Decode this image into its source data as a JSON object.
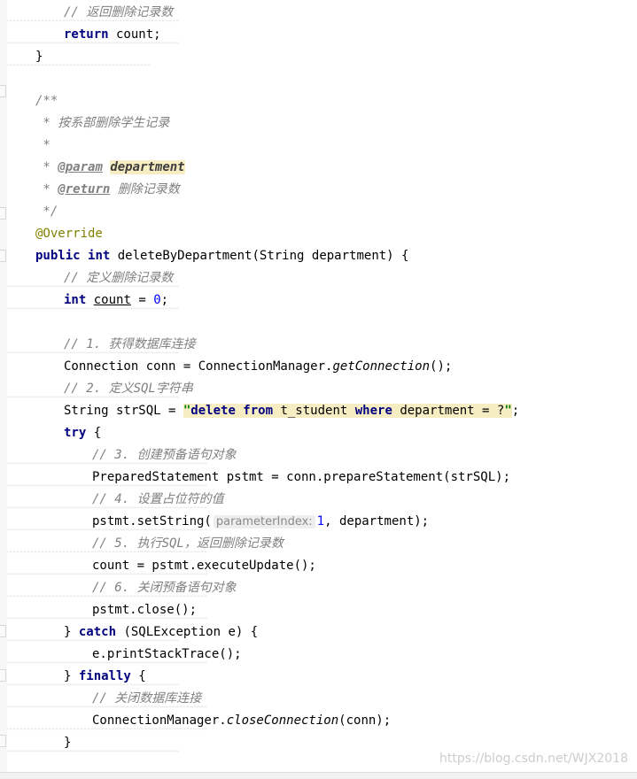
{
  "editor": {
    "code_lines": [
      {
        "tokens": [
          {
            "c": "cm",
            "t": "// 返回删除记录数"
          }
        ]
      },
      {
        "tokens": [
          {
            "c": "kw",
            "t": "return"
          },
          {
            "c": "",
            "t": " count;"
          }
        ]
      },
      {
        "tokens": [
          {
            "c": "",
            "t": "}"
          }
        ]
      },
      {
        "tokens": []
      },
      {
        "tokens": [
          {
            "c": "cm",
            "t": "/**"
          }
        ]
      },
      {
        "tokens": [
          {
            "c": "cm",
            "t": " * 按系部删除学生记录"
          }
        ]
      },
      {
        "tokens": [
          {
            "c": "cm",
            "t": " *"
          }
        ]
      },
      {
        "tokens": [
          {
            "c": "cm",
            "t": " * "
          },
          {
            "c": "tag",
            "t": "@param"
          },
          {
            "c": "cm",
            "t": " "
          },
          {
            "c": "tagval hl",
            "t": "department"
          }
        ]
      },
      {
        "tokens": [
          {
            "c": "cm",
            "t": " * "
          },
          {
            "c": "tag",
            "t": "@return"
          },
          {
            "c": "cm",
            "t": " 删除记录数"
          }
        ]
      },
      {
        "tokens": [
          {
            "c": "cm",
            "t": " */"
          }
        ]
      },
      {
        "tokens": [
          {
            "c": "ann",
            "t": "@Override"
          }
        ]
      },
      {
        "tokens": [
          {
            "c": "kw",
            "t": "public"
          },
          {
            "c": "",
            "t": " "
          },
          {
            "c": "kw",
            "t": "int"
          },
          {
            "c": "",
            "t": " deleteByDepartment(String department) {"
          }
        ]
      },
      {
        "tokens": [
          {
            "c": "cm",
            "t": "// 定义删除记录数"
          }
        ]
      },
      {
        "tokens": [
          {
            "c": "kw",
            "t": "int"
          },
          {
            "c": "",
            "t": " "
          },
          {
            "c": "ul",
            "t": "count"
          },
          {
            "c": "",
            "t": " = "
          },
          {
            "c": "num",
            "t": "0"
          },
          {
            "c": "",
            "t": ";"
          }
        ]
      },
      {
        "tokens": []
      },
      {
        "tokens": [
          {
            "c": "cm",
            "t": "// 1. 获得数据库连接"
          }
        ]
      },
      {
        "tokens": [
          {
            "c": "",
            "t": "Connection conn = ConnectionManager."
          },
          {
            "c": "it",
            "t": "getConnection"
          },
          {
            "c": "",
            "t": "();"
          }
        ]
      },
      {
        "tokens": [
          {
            "c": "cm",
            "t": "// 2. 定义SQL字符串"
          }
        ]
      },
      {
        "tokens": [
          {
            "c": "",
            "t": "String strSQL = "
          },
          {
            "c": "str hl",
            "t": "\""
          },
          {
            "c": "strkw hl",
            "t": "delete from"
          },
          {
            "c": "hl",
            "t": " t_student "
          },
          {
            "c": "strkw hl",
            "t": "where"
          },
          {
            "c": "hl",
            "t": " department = ?"
          },
          {
            "c": "str hl",
            "t": "\""
          },
          {
            "c": "",
            "t": ";"
          }
        ]
      },
      {
        "tokens": [
          {
            "c": "kw",
            "t": "try"
          },
          {
            "c": "",
            "t": " {"
          }
        ]
      },
      {
        "tokens": [
          {
            "c": "cm",
            "t": "// 3. 创建预备语句对象"
          }
        ]
      },
      {
        "tokens": [
          {
            "c": "",
            "t": "PreparedStatement pstmt = conn.prepareStatement(strSQL);"
          }
        ]
      },
      {
        "tokens": [
          {
            "c": "cm",
            "t": "// 4. 设置占位符的值"
          }
        ]
      },
      {
        "tokens": [
          {
            "c": "",
            "t": "pstmt.setString("
          },
          {
            "c": "hint",
            "t": "parameterIndex:"
          },
          {
            "c": "num",
            "t": "1"
          },
          {
            "c": "",
            "t": ", department);"
          }
        ]
      },
      {
        "tokens": [
          {
            "c": "cm",
            "t": "// 5. 执行SQL，返回删除记录数"
          }
        ]
      },
      {
        "tokens": [
          {
            "c": "",
            "t": "count = pstmt.executeUpdate();"
          }
        ]
      },
      {
        "tokens": [
          {
            "c": "cm",
            "t": "// 6. 关闭预备语句对象"
          }
        ]
      },
      {
        "tokens": [
          {
            "c": "",
            "t": "pstmt.close();"
          }
        ]
      },
      {
        "tokens": [
          {
            "c": "",
            "t": "} "
          },
          {
            "c": "kw",
            "t": "catch"
          },
          {
            "c": "",
            "t": " (SQLException e) {"
          }
        ]
      },
      {
        "tokens": [
          {
            "c": "",
            "t": "e.printStackTrace();"
          }
        ]
      },
      {
        "tokens": [
          {
            "c": "",
            "t": "} "
          },
          {
            "c": "kw",
            "t": "finally"
          },
          {
            "c": "",
            "t": " {"
          }
        ]
      },
      {
        "tokens": [
          {
            "c": "cm",
            "t": "// 关闭数据库连接"
          }
        ]
      },
      {
        "tokens": [
          {
            "c": "",
            "t": "ConnectionManager."
          },
          {
            "c": "it",
            "t": "closeConnection"
          },
          {
            "c": "",
            "t": "(conn);"
          }
        ]
      },
      {
        "tokens": [
          {
            "c": "",
            "t": "}"
          }
        ]
      }
    ]
  },
  "watermark": "https://blog.csdn.net/WJX2018",
  "colors": {
    "keyword": "#000080",
    "comment": "#808080",
    "number": "#0000ff",
    "annotation": "#808000",
    "string": "#008000",
    "highlight": "#f7edc3"
  }
}
